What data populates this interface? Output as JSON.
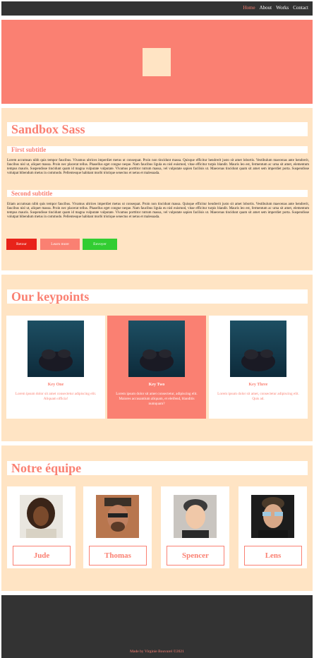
{
  "nav": {
    "links": [
      "Home",
      "About",
      "Works",
      "Contact"
    ]
  },
  "intro": {
    "title": "Sandbox Sass",
    "subtitle1": "First subtitle",
    "para1": "Lorem accumsan nibh quis tempor faucibus. Vivamus ultrices imperdiet metus ut consequat. Proin non tincidunt massa. Quisque efficitur hendrerit justo sit amet lobortis. Vestibulum maecenas ante hendrerit, faucibus nisl ut, aliquet massa. Proin nec placerat tellus. Phasellus eget congue neque. Nam faucibus ligula eu nisl euismod, vitae efficitur turpis blandit. Mauris leo est, fermentum ac urna sit amet, elementum tempus mauris. Suspendisse tincidunt quam id magna vulputate vulputate. Vivamus porttitor rutrum massa, vel vulputate sapien facilisis ut. Maecenas tincidunt quam sit amet sem imperdiet porta. Suspendisse volutpat bibendum metus in commodo. Pellentesque habitant morbi tristique senectus et netus et malesuada.",
    "subtitle2": "Second subtitle",
    "para2": "Etiam accumsan nibh quis tempor faucibus. Vivamus ultrices imperdiet metus ut consequat. Proin non tincidunt massa. Quisque efficitur hendrerit justo sit amet lobortis. Vestibulum maecenas ante hendrerit, faucibus nisl ut, aliquet massa. Proin nec placerat tellus. Phasellus eget congue neque. Nam faucibus ligula eu nisl euismod, vitae efficitur turpis blandit. Mauris leo est, fermentum ac urna sit amet, elementum tempus mauris. Suspendisse tincidunt quam id magna vulputate vulputate. Vivamus porttitor rutrum massa, vel vulputate sapien facilisis ut. Maecenas tincidunt quam sit amet sem imperdiet porta. Suspendisse volutpat bibendum metus in commodo. Pellentesque habitant morbi tristique senectus et netus et malesuada.",
    "buttons": {
      "retour": "Retour",
      "learn": "Learn more",
      "envoyer": "Envoyer"
    }
  },
  "keypoints": {
    "title": "Our keypoints",
    "cards": [
      {
        "name": "Key One",
        "text": "Lorem ipsum dolor sit amet consectetur adipiscing elit. Aliquam officia!"
      },
      {
        "name": "Key Two",
        "text": "Lorem ipsum dolor sit amet consectetur, adipiscing elit. Maiores accusantium aliquam, et eleifend, blanditis numquam?"
      },
      {
        "name": "Key Three",
        "text": "Lorem ipsum dolor sit amet, consectetur adipiscing elit. Quis ad."
      }
    ]
  },
  "team": {
    "title": "Notre équipe",
    "members": [
      "Jude",
      "Thomas",
      "Spencer",
      "Lens"
    ]
  },
  "footer": {
    "text": "Made by Virginie Bouvarel ©2021"
  },
  "colors": {
    "accent": "#fa8072",
    "sand": "#ffe4c4",
    "dark": "#333333",
    "red": "#e8231a",
    "green": "#32cd32"
  }
}
